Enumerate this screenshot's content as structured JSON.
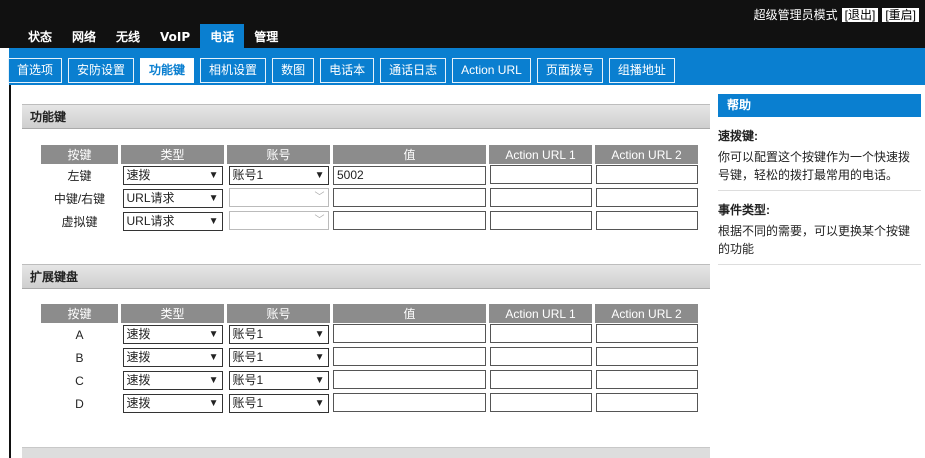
{
  "header": {
    "mode_label": "超级管理员模式",
    "logout_label": "[退出]",
    "reboot_label": "[重启]"
  },
  "main_tabs": [
    "状态",
    "网络",
    "无线",
    "VoIP",
    "电话",
    "管理"
  ],
  "sub_tabs": [
    "首选项",
    "安防设置",
    "功能键",
    "相机设置",
    "数图",
    "电话本",
    "通话日志",
    "Action URL",
    "页面拨号",
    "组播地址"
  ],
  "function_keys": {
    "title": "功能键",
    "columns": [
      "按键",
      "类型",
      "账号",
      "值",
      "Action URL 1",
      "Action URL 2"
    ],
    "rows": [
      {
        "key": "左键",
        "type": "速拨",
        "account": "账号1",
        "value": "5002",
        "url1": "",
        "url2": ""
      },
      {
        "key": "中键/右键",
        "type": "URL请求",
        "account": "",
        "value": "",
        "url1": "",
        "url2": ""
      },
      {
        "key": "虚拟键",
        "type": "URL请求",
        "account": "",
        "value": "",
        "url1": "",
        "url2": ""
      }
    ]
  },
  "extension_keys": {
    "title": "扩展键盘",
    "columns": [
      "按键",
      "类型",
      "账号",
      "值",
      "Action URL 1",
      "Action URL 2"
    ],
    "rows": [
      {
        "key": "A",
        "type": "速拨",
        "account": "账号1",
        "value": "",
        "url1": "",
        "url2": ""
      },
      {
        "key": "B",
        "type": "速拨",
        "account": "账号1",
        "value": "",
        "url1": "",
        "url2": ""
      },
      {
        "key": "C",
        "type": "速拨",
        "account": "账号1",
        "value": "",
        "url1": "",
        "url2": ""
      },
      {
        "key": "D",
        "type": "速拨",
        "account": "账号1",
        "value": "",
        "url1": "",
        "url2": ""
      }
    ]
  },
  "help": {
    "title": "帮助",
    "items": [
      {
        "title": "速拨键:",
        "desc": "你可以配置这个按键作为一个快速拨号键，轻松的拨打最常用的电话。"
      },
      {
        "title": "事件类型:",
        "desc": "根据不同的需要，可以更换某个按键的功能"
      }
    ]
  },
  "colors": {
    "accent": "#0a7fd0",
    "header_bg": "#111111",
    "column_header": "#8c8c8c"
  }
}
